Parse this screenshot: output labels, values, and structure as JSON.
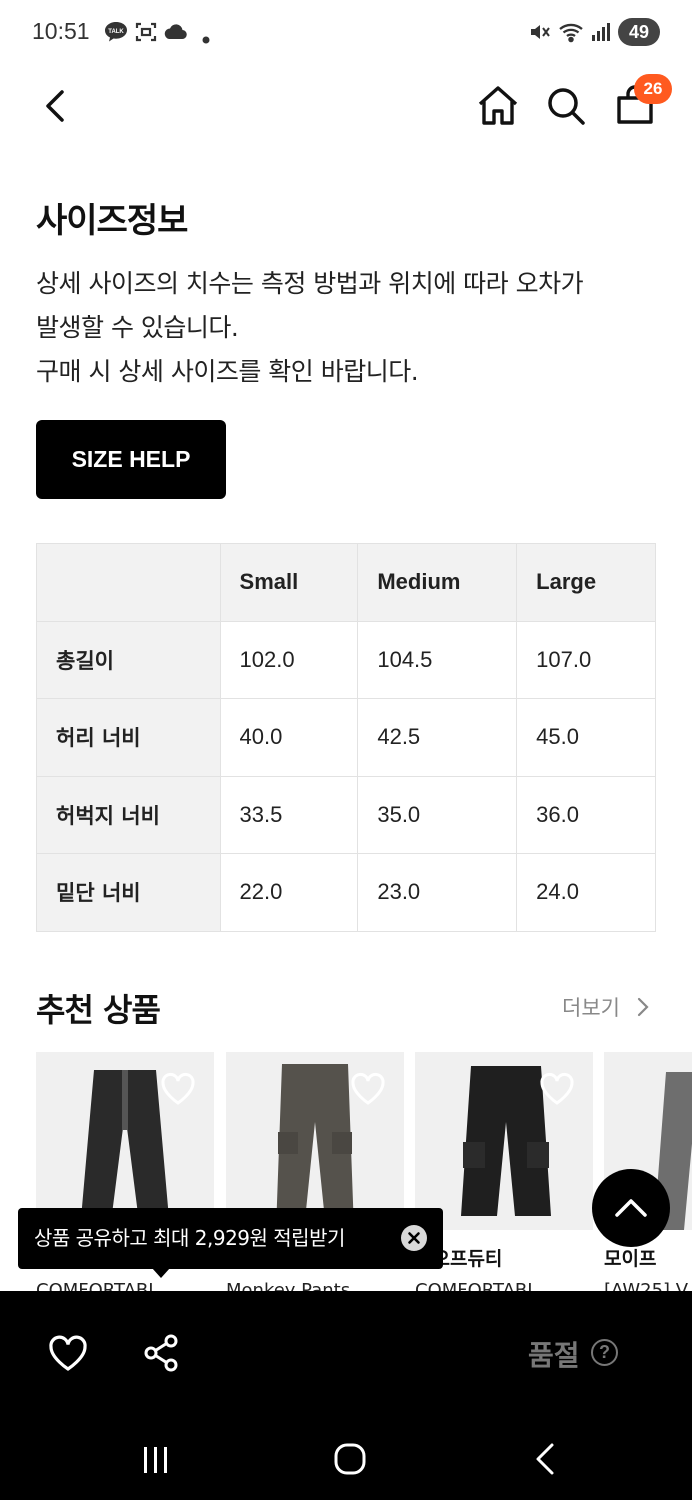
{
  "status_bar": {
    "time": "10:51",
    "battery": "49"
  },
  "header": {
    "cart_badge": "26",
    "icons": [
      "back-arrow-icon",
      "home-icon",
      "search-icon",
      "shopping-bag-icon"
    ]
  },
  "size_info": {
    "title": "사이즈정보",
    "description": [
      "상세 사이즈의 치수는 측정 방법과 위치에 따라 오차가",
      "발생할 수 있습니다.",
      "구매 시 상세 사이즈를 확인 바랍니다."
    ],
    "size_help_label": "SIZE HELP",
    "table": {
      "headers": [
        "",
        "Small",
        "Medium",
        "Large"
      ],
      "rows": [
        {
          "label": "총길이",
          "values": [
            "102.0",
            "104.5",
            "107.0"
          ]
        },
        {
          "label": "허리 너비",
          "values": [
            "40.0",
            "42.5",
            "45.0"
          ]
        },
        {
          "label": "허벅지 너비",
          "values": [
            "33.5",
            "35.0",
            "36.0"
          ]
        },
        {
          "label": "밑단 너비",
          "values": [
            "22.0",
            "23.0",
            "24.0"
          ]
        }
      ]
    }
  },
  "recommended": {
    "title": "추천 상품",
    "more_label": "더보기",
    "items": [
      {
        "brand": "",
        "name": "COMFORTABL",
        "image_color": "#2a2a2a"
      },
      {
        "brand": "",
        "name": "Monkey Pants",
        "image_color": "#55524c"
      },
      {
        "brand": "브오프듀티",
        "name": "COMFORTABL",
        "image_color": "#1f1f1f"
      },
      {
        "brand": "모이프",
        "name": "[AW25] V",
        "image_color": "#6e6e6e"
      }
    ]
  },
  "toast": {
    "text": "상품 공유하고 최대 2,929원 적립받기"
  },
  "bottom_bar": {
    "status_label": "품절",
    "help_glyph": "?"
  },
  "colors": {
    "accent": "#ff5a1f",
    "dark": "#000000"
  }
}
